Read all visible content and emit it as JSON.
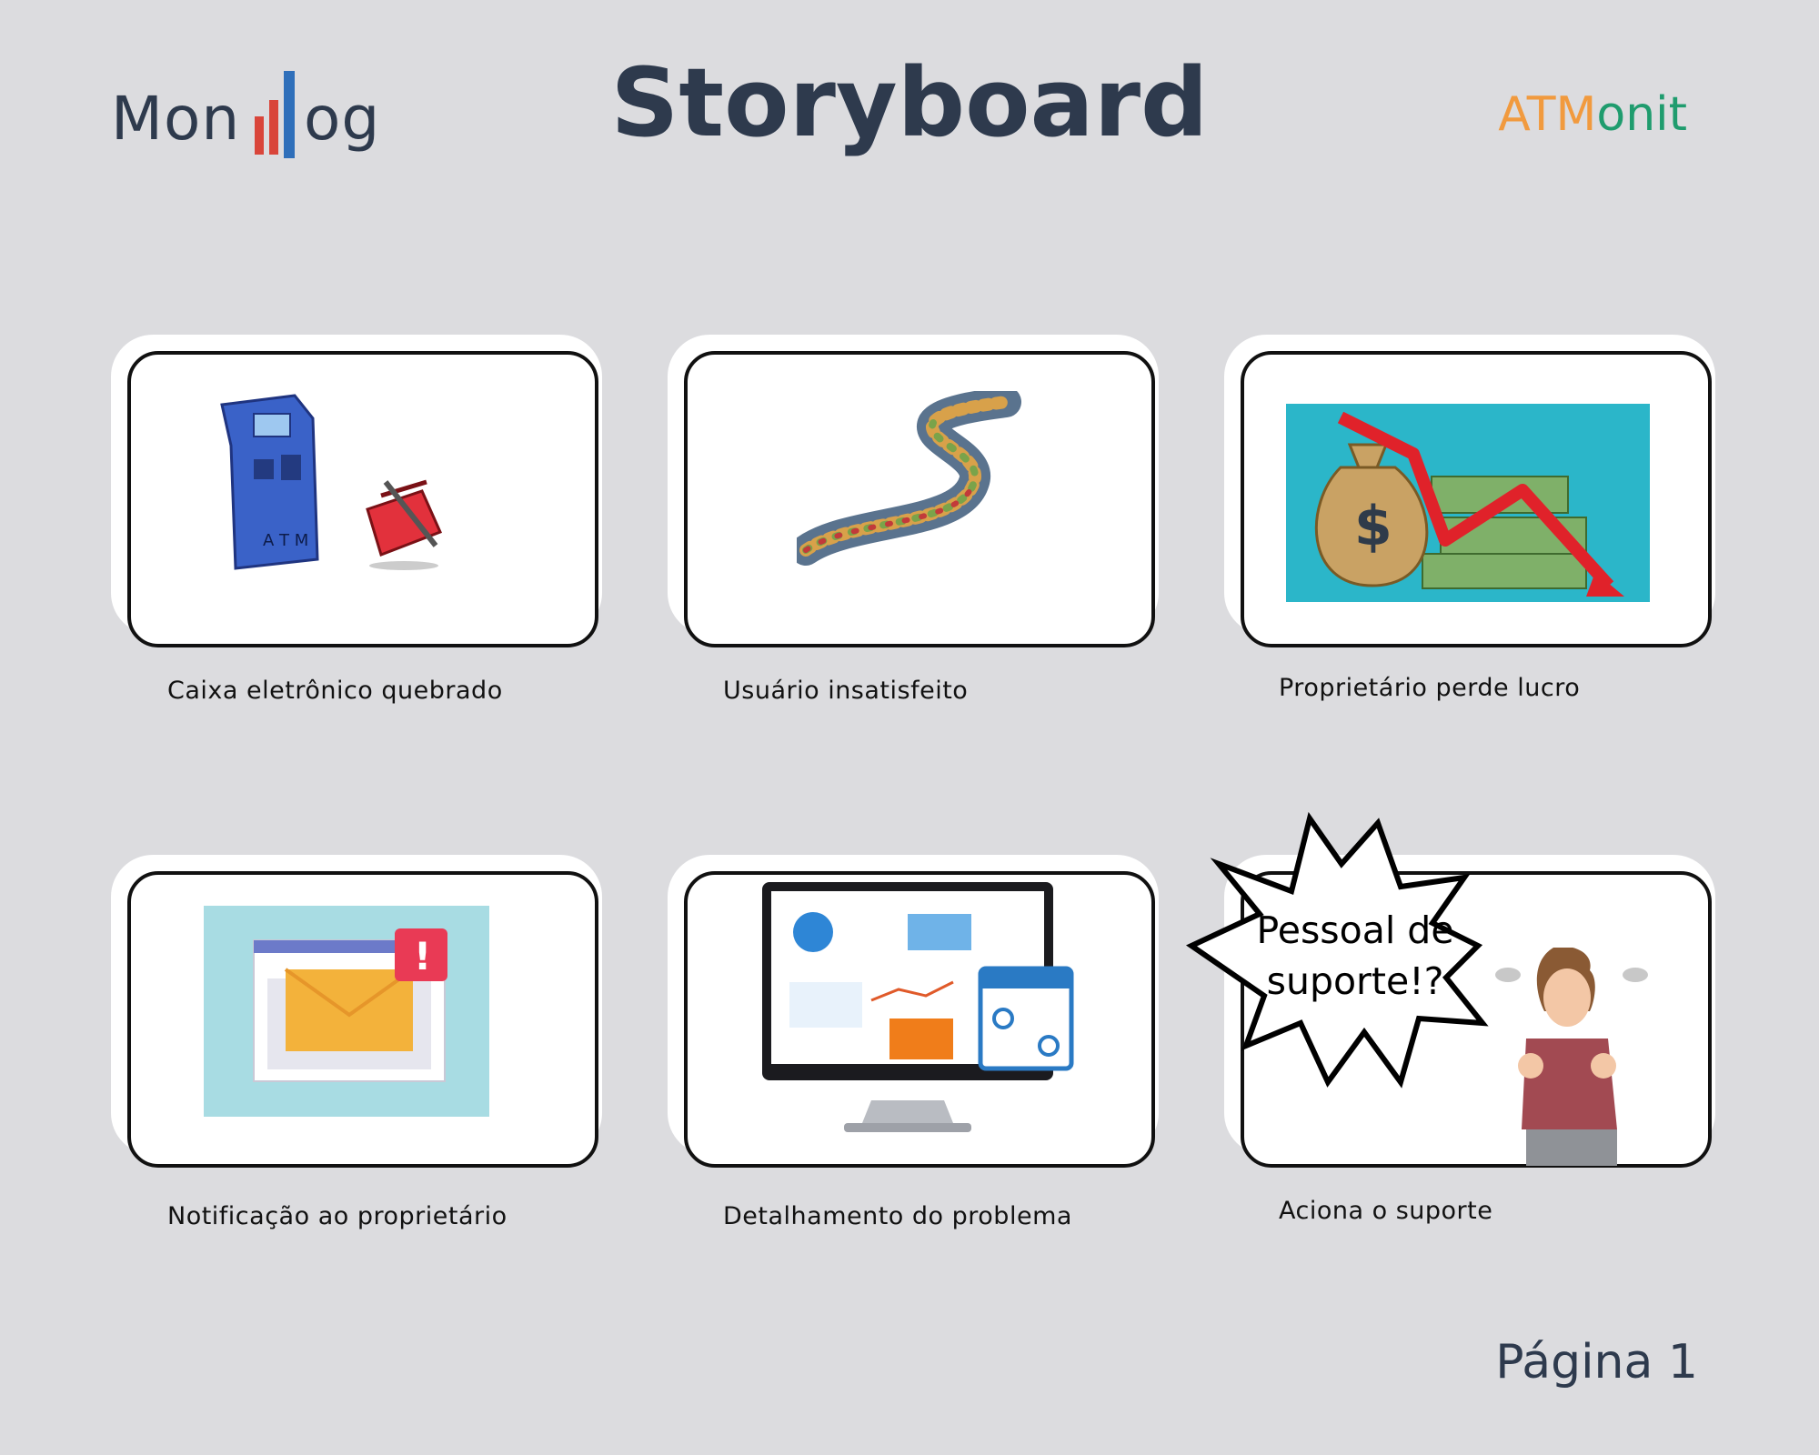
{
  "header": {
    "logo_left_part1": "Mon",
    "logo_left_part2": "og",
    "title": "Storyboard",
    "logo_right_part1": "ATM",
    "logo_right_part2": "onit"
  },
  "panels": [
    {
      "caption": "Caixa eletrônico quebrado",
      "art": "atm-and-toolbox"
    },
    {
      "caption": "Usuário insatisfeito",
      "art": "crowd-queue"
    },
    {
      "caption": "Proprietário perde lucro",
      "art": "money-bag-falling-chart"
    },
    {
      "caption": "Notificação ao proprietário",
      "art": "email-notification"
    },
    {
      "caption": "Detalhamento do problema",
      "art": "dashboard-monitor"
    },
    {
      "caption": "Aciona o suporte",
      "art": "angry-man"
    }
  ],
  "speech_bubble": {
    "line1": "Pessoal de",
    "line2": "suporte!?"
  },
  "footer": {
    "page": "Página 1"
  },
  "colors": {
    "background": "#dcdcdf",
    "text_dark": "#2e3a4d",
    "atmonit_orange": "#f19a3e",
    "atmonit_green": "#1f9c6e"
  }
}
